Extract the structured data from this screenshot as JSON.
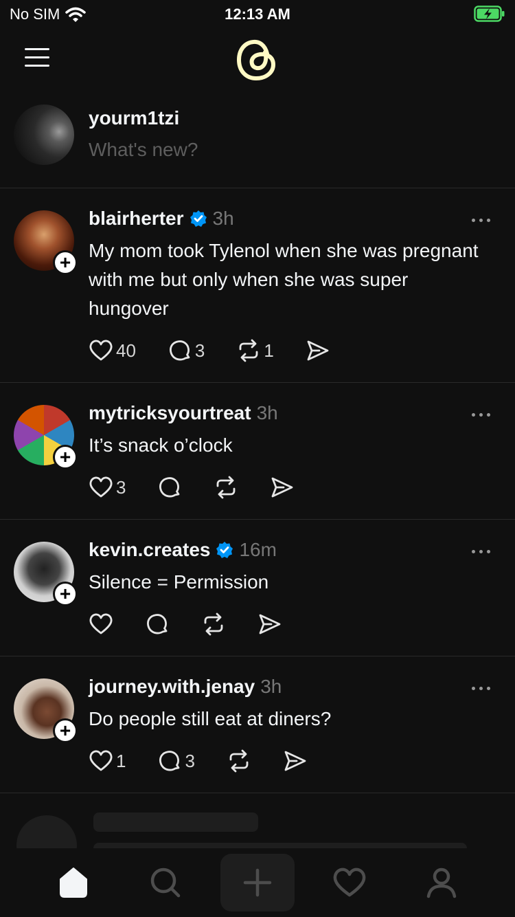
{
  "status_bar": {
    "carrier": "No SIM",
    "time": "12:13 AM"
  },
  "composer": {
    "username": "yourm1tzi",
    "placeholder": "What's new?"
  },
  "posts": [
    {
      "username": "blairherter",
      "verified": true,
      "time": "3h",
      "text": "My mom took Tylenol when she was pregnant with me but only when she was super hungover",
      "likes": "40",
      "replies": "3",
      "reposts": "1"
    },
    {
      "username": "mytricksyourtreat",
      "verified": false,
      "time": "3h",
      "text": "It’s snack o’clock",
      "likes": "3",
      "replies": "",
      "reposts": ""
    },
    {
      "username": "kevin.creates",
      "verified": true,
      "time": "16m",
      "text": "Silence = Permission",
      "likes": "",
      "replies": "",
      "reposts": ""
    },
    {
      "username": "journey.with.jenay",
      "verified": false,
      "time": "3h",
      "text": "Do people still eat at diners?",
      "likes": "1",
      "replies": "3",
      "reposts": ""
    }
  ],
  "tabs": [
    "home-icon",
    "search-icon",
    "compose-icon",
    "heart-icon",
    "profile-icon"
  ],
  "colors": {
    "background": "#101010",
    "verified": "#0095f6",
    "logo": "#fff9c4",
    "battery": "#4cd964"
  }
}
